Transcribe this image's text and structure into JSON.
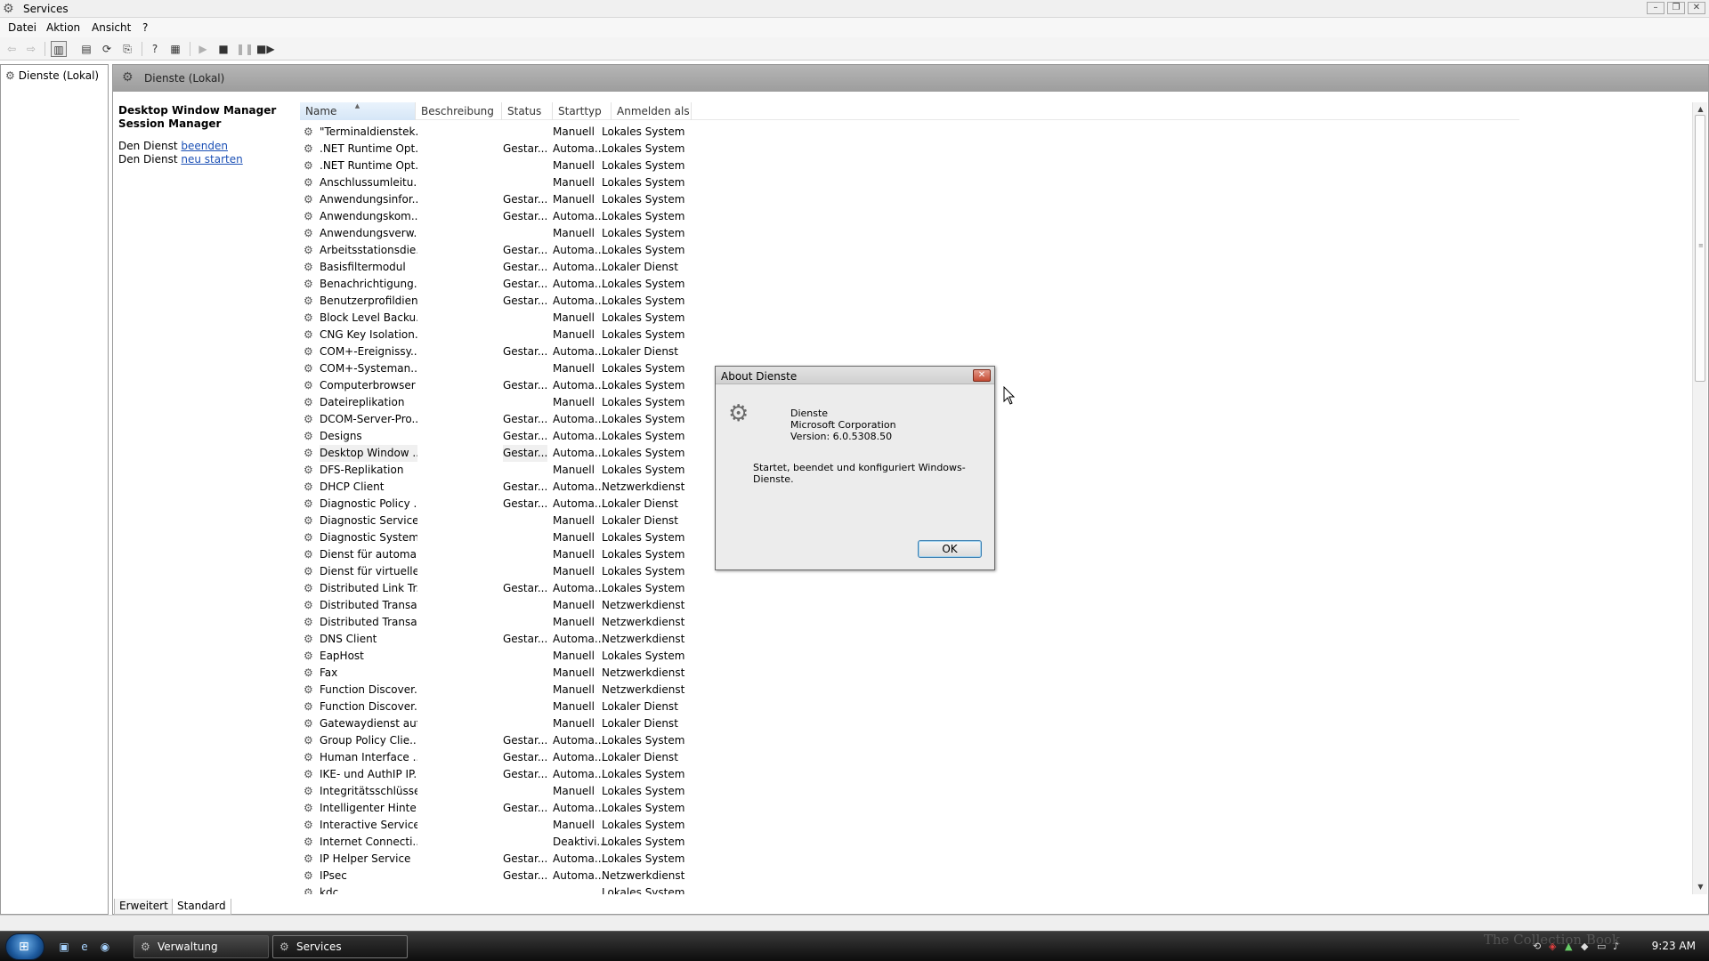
{
  "window": {
    "title": "Services",
    "icon": "gears-icon"
  },
  "menu": [
    "Datei",
    "Aktion",
    "Ansicht",
    "?"
  ],
  "tree": {
    "root_label": "Dienste (Lokal)"
  },
  "main": {
    "header_title": "Dienste (Lokal)",
    "selected_service_title": "Desktop Window Manager Session Manager",
    "actions": [
      {
        "prefix": "Den Dienst ",
        "link": "beenden"
      },
      {
        "prefix": "Den Dienst ",
        "link": "neu starten"
      }
    ]
  },
  "columns": [
    "Name",
    "Beschreibung",
    "Status",
    "Starttyp",
    "Anmelden als"
  ],
  "services": [
    {
      "name": "\"Terminaldienstek...",
      "status": "",
      "start": "Manuell",
      "logon": "Lokales System"
    },
    {
      "name": ".NET Runtime Opt...",
      "status": "Gestar...",
      "start": "Automa...",
      "logon": "Lokales System"
    },
    {
      "name": ".NET Runtime Opt...",
      "status": "",
      "start": "Manuell",
      "logon": "Lokales System"
    },
    {
      "name": "Anschlussumleitu...",
      "status": "",
      "start": "Manuell",
      "logon": "Lokales System"
    },
    {
      "name": "Anwendungsinfor...",
      "status": "Gestar...",
      "start": "Manuell",
      "logon": "Lokales System"
    },
    {
      "name": "Anwendungskom...",
      "status": "Gestar...",
      "start": "Automa...",
      "logon": "Lokales System"
    },
    {
      "name": "Anwendungsverw...",
      "status": "",
      "start": "Manuell",
      "logon": "Lokales System"
    },
    {
      "name": "Arbeitsstationsdie...",
      "status": "Gestar...",
      "start": "Automa...",
      "logon": "Lokales System"
    },
    {
      "name": "Basisfiltermodul",
      "status": "Gestar...",
      "start": "Automa...",
      "logon": "Lokaler Dienst"
    },
    {
      "name": "Benachrichtigung...",
      "status": "Gestar...",
      "start": "Automa...",
      "logon": "Lokales System"
    },
    {
      "name": "Benutzerprofildienst",
      "status": "Gestar...",
      "start": "Automa...",
      "logon": "Lokales System"
    },
    {
      "name": "Block Level Backu...",
      "status": "",
      "start": "Manuell",
      "logon": "Lokales System"
    },
    {
      "name": "CNG Key Isolation...",
      "status": "",
      "start": "Manuell",
      "logon": "Lokales System"
    },
    {
      "name": "COM+-Ereignissy...",
      "status": "Gestar...",
      "start": "Automa...",
      "logon": "Lokaler Dienst"
    },
    {
      "name": "COM+-Systeman...",
      "status": "",
      "start": "Manuell",
      "logon": "Lokales System"
    },
    {
      "name": "Computerbrowser",
      "status": "Gestar...",
      "start": "Automa...",
      "logon": "Lokales System"
    },
    {
      "name": "Dateireplikation",
      "status": "",
      "start": "Manuell",
      "logon": "Lokales System"
    },
    {
      "name": "DCOM-Server-Pro...",
      "status": "Gestar...",
      "start": "Automa...",
      "logon": "Lokales System"
    },
    {
      "name": "Designs",
      "status": "Gestar...",
      "start": "Automa...",
      "logon": "Lokales System"
    },
    {
      "name": "Desktop Window ...",
      "status": "Gestar...",
      "start": "Automa...",
      "logon": "Lokales System"
    },
    {
      "name": "DFS-Replikation",
      "status": "",
      "start": "Manuell",
      "logon": "Lokales System"
    },
    {
      "name": "DHCP Client",
      "status": "Gestar...",
      "start": "Automa...",
      "logon": "Netzwerkdienst"
    },
    {
      "name": "Diagnostic Policy ...",
      "status": "Gestar...",
      "start": "Automa...",
      "logon": "Lokaler Dienst"
    },
    {
      "name": "Diagnostic Service...",
      "status": "",
      "start": "Manuell",
      "logon": "Lokaler Dienst"
    },
    {
      "name": "Diagnostic System...",
      "status": "",
      "start": "Manuell",
      "logon": "Lokales System"
    },
    {
      "name": "Dienst für automa...",
      "status": "",
      "start": "Manuell",
      "logon": "Lokales System"
    },
    {
      "name": "Dienst für virtuelle...",
      "status": "",
      "start": "Manuell",
      "logon": "Lokales System"
    },
    {
      "name": "Distributed Link Tr...",
      "status": "Gestar...",
      "start": "Automa...",
      "logon": "Lokales System"
    },
    {
      "name": "Distributed Transa...",
      "status": "",
      "start": "Manuell",
      "logon": "Netzwerkdienst"
    },
    {
      "name": "Distributed Transa...",
      "status": "",
      "start": "Manuell",
      "logon": "Netzwerkdienst"
    },
    {
      "name": "DNS Client",
      "status": "Gestar...",
      "start": "Automa...",
      "logon": "Netzwerkdienst"
    },
    {
      "name": "EapHost",
      "status": "",
      "start": "Manuell",
      "logon": "Lokales System"
    },
    {
      "name": "Fax",
      "status": "",
      "start": "Manuell",
      "logon": "Netzwerkdienst"
    },
    {
      "name": "Function Discover...",
      "status": "",
      "start": "Manuell",
      "logon": "Netzwerkdienst"
    },
    {
      "name": "Function Discover...",
      "status": "",
      "start": "Manuell",
      "logon": "Lokaler Dienst"
    },
    {
      "name": "Gatewaydienst auf...",
      "status": "",
      "start": "Manuell",
      "logon": "Lokaler Dienst"
    },
    {
      "name": "Group Policy Clie...",
      "status": "Gestar...",
      "start": "Automa...",
      "logon": "Lokales System"
    },
    {
      "name": "Human Interface ...",
      "status": "Gestar...",
      "start": "Automa...",
      "logon": "Lokaler Dienst"
    },
    {
      "name": "IKE- und AuthIP IP...",
      "status": "Gestar...",
      "start": "Automa...",
      "logon": "Lokales System"
    },
    {
      "name": "Integritätsschlüsse...",
      "status": "",
      "start": "Manuell",
      "logon": "Lokales System"
    },
    {
      "name": "Intelligenter Hinte...",
      "status": "Gestar...",
      "start": "Automa...",
      "logon": "Lokales System"
    },
    {
      "name": "Interactive Service...",
      "status": "",
      "start": "Manuell",
      "logon": "Lokales System"
    },
    {
      "name": "Internet Connecti...",
      "status": "",
      "start": "Deaktivi...",
      "logon": "Lokales System"
    },
    {
      "name": "IP Helper Service",
      "status": "Gestar...",
      "start": "Automa...",
      "logon": "Lokales System"
    },
    {
      "name": "IPsec",
      "status": "Gestar...",
      "start": "Automa...",
      "logon": "Netzwerkdienst"
    },
    {
      "name": "kdc",
      "status": "",
      "start": "",
      "logon": "Lokales System"
    }
  ],
  "selected_index": 19,
  "tabs": [
    "Erweitert",
    "Standard"
  ],
  "dialog": {
    "title": "About Dienste",
    "app_name": "Dienste",
    "company": "Microsoft Corporation",
    "version": "Version: 6.0.5308.50",
    "description": "Startet, beendet und konfiguriert Windows-Dienste.",
    "ok_label": "OK"
  },
  "taskbar": {
    "buttons": [
      "Verwaltung",
      "Services"
    ],
    "clock": "9:23 AM",
    "watermark": "The Collection Book"
  }
}
